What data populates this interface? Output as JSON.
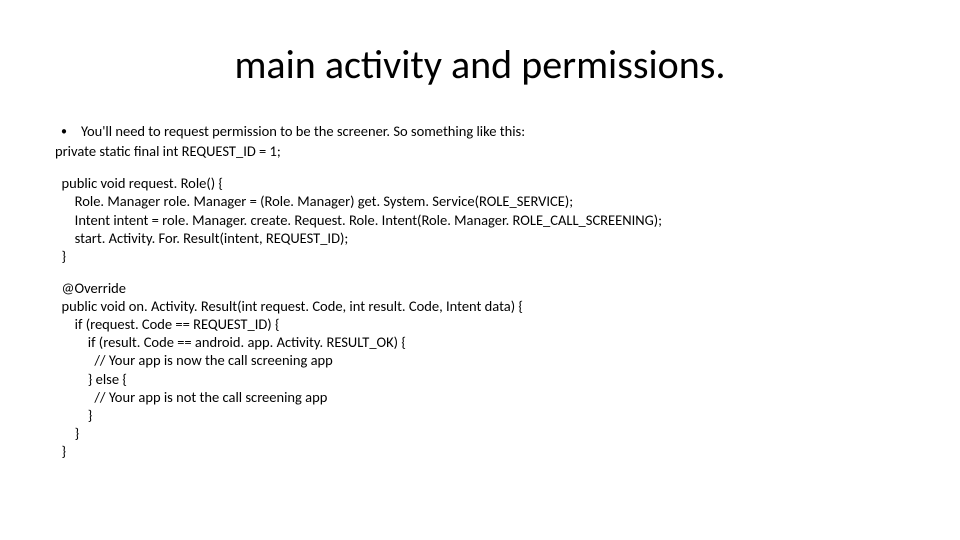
{
  "slide": {
    "title": "main activity and permissions.",
    "bullet": "You'll need to request permission to be the screener.   So something like this:",
    "line_private": "private static final int REQUEST_ID = 1;",
    "code1": "  public void request. Role() {\n      Role. Manager role. Manager = (Role. Manager) get. System. Service(ROLE_SERVICE);\n      Intent intent = role. Manager. create. Request. Role. Intent(Role. Manager. ROLE_CALL_SCREENING);\n      start. Activity. For. Result(intent, REQUEST_ID);\n  }",
    "code2": "  @Override\n  public void on. Activity. Result(int request. Code, int result. Code, Intent data) {\n      if (request. Code == REQUEST_ID) {\n          if (result. Code == android. app. Activity. RESULT_OK) {\n            // Your app is now the call screening app\n          } else {\n            // Your app is not the call screening app\n          }\n      }\n  }"
  }
}
